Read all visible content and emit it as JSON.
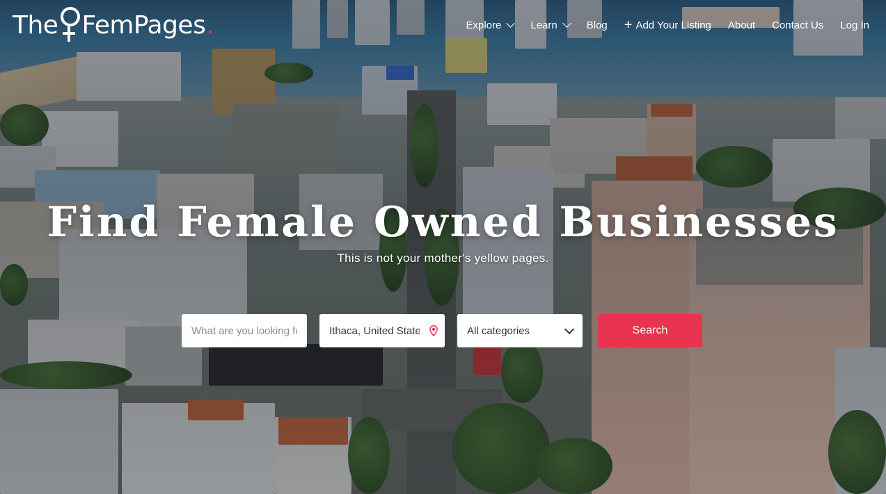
{
  "brand": {
    "logo_before": "The",
    "logo_after": "FemPages",
    "logo_dot": "."
  },
  "nav": {
    "items": [
      {
        "label": "Explore",
        "dropdown": true
      },
      {
        "label": "Learn",
        "dropdown": true
      },
      {
        "label": "Blog",
        "dropdown": false
      },
      {
        "label": "Add Your Listing",
        "icon": "plus-icon",
        "dropdown": false
      },
      {
        "label": "About",
        "dropdown": false
      },
      {
        "label": "Contact Us",
        "dropdown": false
      },
      {
        "label": "Log In",
        "dropdown": false
      }
    ]
  },
  "hero": {
    "title": "Find Female Owned Businesses",
    "subtitle": "This is not your mother's yellow pages."
  },
  "search": {
    "what_placeholder": "What are you looking for?",
    "where_value": "Ithaca, United States",
    "where_icon": "location-pin-icon",
    "category_selected": "All categories",
    "button_label": "Search"
  },
  "colors": {
    "accent": "#e8344e",
    "text_light": "#ffffff"
  }
}
